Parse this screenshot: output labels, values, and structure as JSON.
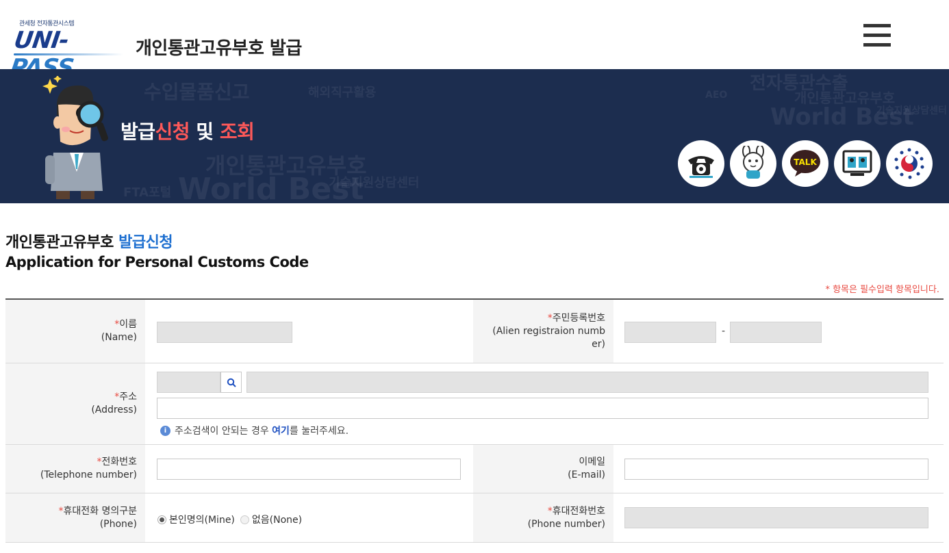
{
  "header": {
    "logo_small": "관세청 전자통관시스템",
    "logo_main_a": "UNI-",
    "logo_main_b": "PASS",
    "title": "개인통관고유부호 발급",
    "menu_icon": "hamburger-menu-icon"
  },
  "banner": {
    "title_a": "발급",
    "title_b": "신청",
    "title_c": " 및 ",
    "title_d": "조회",
    "bg_words": [
      "수입물품신고",
      "해외직구활용",
      "개인통관고유부호",
      "World Best",
      "기술지원상담센터",
      "전자통관수출",
      "FTA포털",
      "AEO",
      "해외직구"
    ],
    "icons": [
      "telephone-icon",
      "mascot-icon",
      "kakaotalk-icon",
      "remote-support-icon",
      "government-emblem-icon"
    ],
    "talk_label": "TALK"
  },
  "section": {
    "title_ko_a": "개인통관고유부호 ",
    "title_ko_b": "발급신청",
    "title_en": "Application for Personal Customs Code",
    "required_note": "* 항목은 필수입력 항목입니다."
  },
  "form": {
    "name": {
      "star": "*",
      "ko": "이름",
      "en": "(Name)",
      "value": ""
    },
    "alien_reg": {
      "star": "*",
      "ko": "주민등록번호",
      "en_line1": "(Alien registraion numb",
      "en_line2": "er)",
      "separator": "-"
    },
    "address": {
      "star": "*",
      "ko": "주소",
      "en": "(Address)",
      "help_pre": "주소검색이 안되는 경우 ",
      "help_link": "여기",
      "help_post": "를 눌러주세요."
    },
    "telephone": {
      "star": "*",
      "ko": "전화번호",
      "en": "(Telephone number)"
    },
    "email": {
      "ko": "이메일",
      "en": "(E-mail)"
    },
    "phone_owner": {
      "star": "*",
      "ko": "휴대전화 명의구분",
      "en": "(Phone)",
      "opt_mine": "본인명의(Mine)",
      "opt_none": "없음(None)",
      "selected": "본인명의(Mine)"
    },
    "phone_number": {
      "star": "*",
      "ko": "휴대전화번호",
      "en": "(Phone number)"
    }
  }
}
